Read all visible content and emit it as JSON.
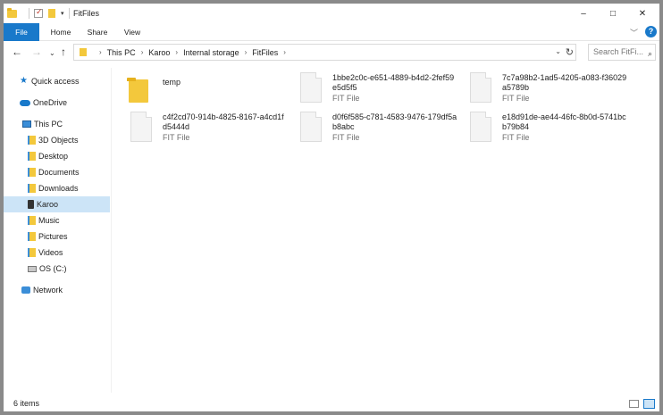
{
  "window": {
    "title": "FitFiles",
    "controls": {
      "minimize": "–",
      "maximize": "□",
      "close": "✕"
    }
  },
  "ribbon": {
    "tabs": [
      {
        "label": "File"
      },
      {
        "label": "Home"
      },
      {
        "label": "Share"
      },
      {
        "label": "View"
      }
    ],
    "expand_icon": "chevron-down-icon",
    "help_label": "?"
  },
  "address_bar": {
    "breadcrumbs": [
      "This PC",
      "Karoo",
      "Internal storage",
      "FitFiles"
    ],
    "search_placeholder": "Search FitFi..."
  },
  "sidebar": {
    "items": [
      {
        "label": "Quick access",
        "icon": "star-icon"
      },
      {
        "label": "OneDrive",
        "icon": "cloud-icon"
      },
      {
        "label": "This PC",
        "icon": "computer-icon"
      },
      {
        "label": "3D Objects",
        "icon": "folder-icon"
      },
      {
        "label": "Desktop",
        "icon": "folder-icon"
      },
      {
        "label": "Documents",
        "icon": "folder-icon"
      },
      {
        "label": "Downloads",
        "icon": "folder-icon"
      },
      {
        "label": "Karoo",
        "icon": "device-icon",
        "selected": true
      },
      {
        "label": "Music",
        "icon": "folder-icon"
      },
      {
        "label": "Pictures",
        "icon": "folder-icon"
      },
      {
        "label": "Videos",
        "icon": "folder-icon"
      },
      {
        "label": "OS (C:)",
        "icon": "drive-icon"
      },
      {
        "label": "Network",
        "icon": "network-icon"
      }
    ]
  },
  "files": [
    {
      "name": "temp",
      "type": ""
    },
    {
      "name": "1bbe2c0c-e651-4889-b4d2-2fef59e5d5f5",
      "type": "FIT File"
    },
    {
      "name": "7c7a98b2-1ad5-4205-a083-f36029a5789b",
      "type": "FIT File"
    },
    {
      "name": "c4f2cd70-914b-4825-8167-a4cd1fd5444d",
      "type": "FIT File"
    },
    {
      "name": "d0f6f585-c781-4583-9476-179df5ab8abc",
      "type": "FIT File"
    },
    {
      "name": "e18d91de-ae44-46fc-8b0d-5741bcb79b84",
      "type": "FIT File"
    }
  ],
  "status": {
    "item_count": "6 items"
  },
  "colors": {
    "accent": "#1979ca",
    "selection": "#cce4f7",
    "folder": "#f3c83c"
  }
}
